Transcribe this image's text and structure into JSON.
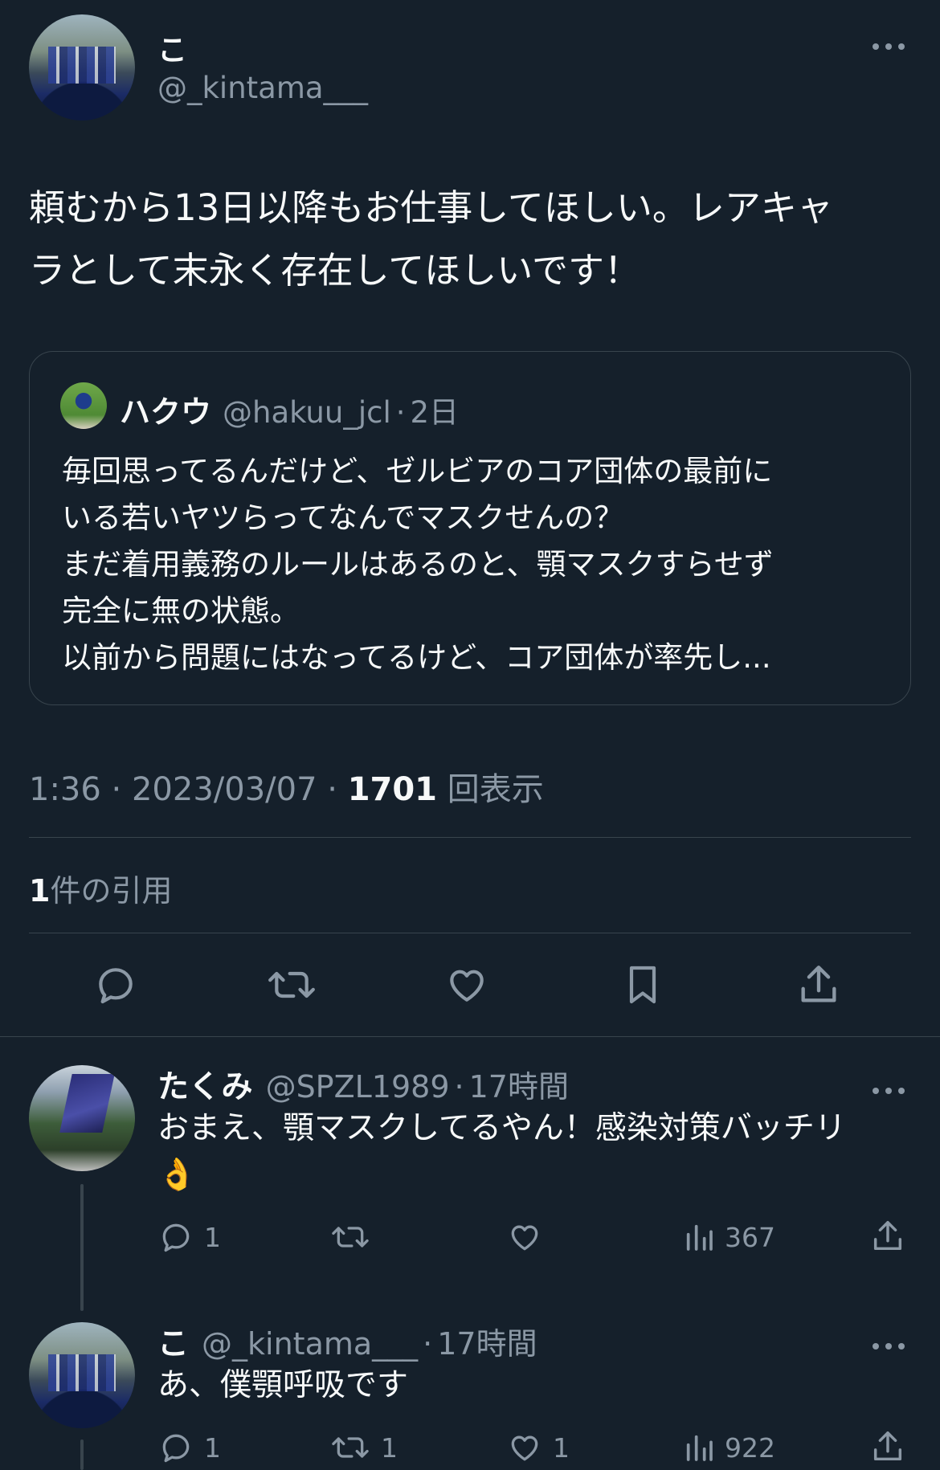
{
  "tweet": {
    "display_name": "こ",
    "handle": "@_kintama___",
    "more_icon": "more-horizontal-icon",
    "text_line1": "頼むから13日以降もお仕事してほしい。レアキャ",
    "text_line2": "ラとして末永く存在してほしいです！",
    "quote": {
      "display_name": "ハクウ",
      "handle": "@hakuu_jcl",
      "time": "2日",
      "text": "毎回思ってるんだけど、ゼルビアのコア団体の最前に\nいる若いヤツらってなんでマスクせんの？\nまだ着用義務のルールはあるのと、顎マスクすらせず\n完全に無の状態。\n以前から問題にはなってるけど、コア団体が率先し..."
    },
    "time": "1:36",
    "date": "2023/03/07",
    "views_count": "1701",
    "views_label": "回表示",
    "quotes_count": "1",
    "quotes_label": "件の引用",
    "actions": [
      "reply-icon",
      "retweet-icon",
      "like-icon",
      "bookmark-icon",
      "share-icon"
    ]
  },
  "replies": [
    {
      "display_name": "たくみ",
      "handle": "@SPZL1989",
      "time": "17時間",
      "text_line1": "おまえ、顎マスクしてるやん！感染対策バッチリ",
      "text_line2": "👌",
      "reply_count": "1",
      "retweet_count": "",
      "like_count": "",
      "views": "367"
    },
    {
      "display_name": "こ",
      "handle": "@_kintama___",
      "time": "17時間",
      "text_line1": "あ、僕顎呼吸です",
      "reply_count": "1",
      "retweet_count": "1",
      "like_count": "1",
      "views": "922"
    }
  ],
  "colors": {
    "background": "#15202b",
    "text": "#f7f9f9",
    "muted": "#8b98a5",
    "border": "#38444d"
  }
}
